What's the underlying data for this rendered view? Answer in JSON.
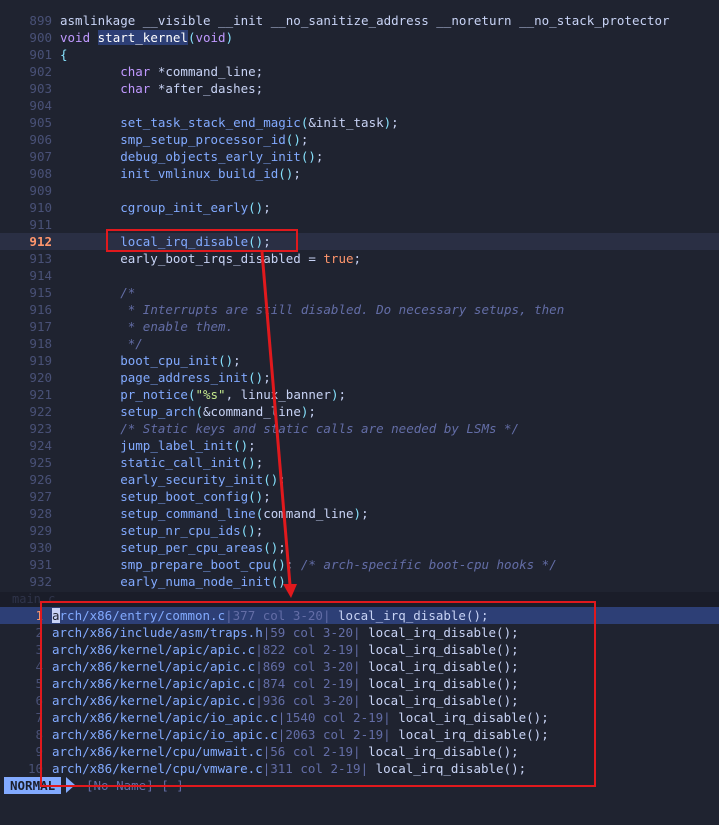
{
  "editor": {
    "lines": [
      {
        "num": "899",
        "parts": [
          [
            "",
            "asmlinkage __visible __init __no_sanitize_address __noreturn __no_stack_protector"
          ]
        ]
      },
      {
        "num": "900",
        "parts": [
          [
            "typ",
            "void"
          ],
          [
            "",
            " "
          ],
          [
            "hl",
            "start_kernel"
          ],
          [
            "punc",
            "("
          ],
          [
            "typ",
            "void"
          ],
          [
            "punc",
            ")"
          ]
        ]
      },
      {
        "num": "901",
        "parts": [
          [
            "punc",
            "{"
          ]
        ]
      },
      {
        "num": "902",
        "parts": [
          [
            "",
            "        "
          ],
          [
            "typ",
            "char"
          ],
          [
            "",
            " *command_line;"
          ]
        ]
      },
      {
        "num": "903",
        "parts": [
          [
            "",
            "        "
          ],
          [
            "typ",
            "char"
          ],
          [
            "",
            " *after_dashes;"
          ]
        ]
      },
      {
        "num": "904",
        "parts": []
      },
      {
        "num": "905",
        "parts": [
          [
            "",
            "        "
          ],
          [
            "fn",
            "set_task_stack_end_magic"
          ],
          [
            "punc",
            "("
          ],
          [
            "",
            "&init_task"
          ],
          [
            "punc",
            ")"
          ],
          [
            "",
            ";"
          ]
        ]
      },
      {
        "num": "906",
        "parts": [
          [
            "",
            "        "
          ],
          [
            "fn",
            "smp_setup_processor_id"
          ],
          [
            "punc",
            "()"
          ],
          [
            "",
            ";"
          ]
        ]
      },
      {
        "num": "907",
        "parts": [
          [
            "",
            "        "
          ],
          [
            "fn",
            "debug_objects_early_init"
          ],
          [
            "punc",
            "()"
          ],
          [
            "",
            ";"
          ]
        ]
      },
      {
        "num": "908",
        "parts": [
          [
            "",
            "        "
          ],
          [
            "fn",
            "init_vmlinux_build_id"
          ],
          [
            "punc",
            "()"
          ],
          [
            "",
            ";"
          ]
        ]
      },
      {
        "num": "909",
        "parts": []
      },
      {
        "num": "910",
        "parts": [
          [
            "",
            "        "
          ],
          [
            "fn",
            "cgroup_init_early"
          ],
          [
            "punc",
            "()"
          ],
          [
            "",
            ";"
          ]
        ]
      },
      {
        "num": "911",
        "parts": []
      },
      {
        "num": "912",
        "current": true,
        "parts": [
          [
            "",
            "        "
          ],
          [
            "fn",
            "local_irq_disable"
          ],
          [
            "punc",
            "()"
          ],
          [
            "",
            ";"
          ]
        ]
      },
      {
        "num": "913",
        "parts": [
          [
            "",
            "        early_boot_irqs_disabled = "
          ],
          [
            "bool",
            "true"
          ],
          [
            "",
            ";"
          ]
        ]
      },
      {
        "num": "914",
        "parts": []
      },
      {
        "num": "915",
        "parts": [
          [
            "",
            "        "
          ],
          [
            "cm",
            "/*"
          ]
        ]
      },
      {
        "num": "916",
        "parts": [
          [
            "",
            "        "
          ],
          [
            "cm",
            " * Interrupts are still disabled. Do necessary setups, then"
          ]
        ]
      },
      {
        "num": "917",
        "parts": [
          [
            "",
            "        "
          ],
          [
            "cm",
            " * enable them."
          ]
        ]
      },
      {
        "num": "918",
        "parts": [
          [
            "",
            "        "
          ],
          [
            "cm",
            " */"
          ]
        ]
      },
      {
        "num": "919",
        "parts": [
          [
            "",
            "        "
          ],
          [
            "fn",
            "boot_cpu_init"
          ],
          [
            "punc",
            "()"
          ],
          [
            "",
            ";"
          ]
        ]
      },
      {
        "num": "920",
        "parts": [
          [
            "",
            "        "
          ],
          [
            "fn",
            "page_address_init"
          ],
          [
            "punc",
            "()"
          ],
          [
            "",
            ";"
          ]
        ]
      },
      {
        "num": "921",
        "parts": [
          [
            "",
            "        "
          ],
          [
            "fn",
            "pr_notice"
          ],
          [
            "punc",
            "("
          ],
          [
            "str",
            "\"%s\""
          ],
          [
            "",
            ", linux_banner"
          ],
          [
            "punc",
            ")"
          ],
          [
            "",
            ";"
          ]
        ]
      },
      {
        "num": "922",
        "parts": [
          [
            "",
            "        "
          ],
          [
            "fn",
            "setup_arch"
          ],
          [
            "punc",
            "("
          ],
          [
            "",
            "&command_line"
          ],
          [
            "punc",
            ")"
          ],
          [
            "",
            ";"
          ]
        ]
      },
      {
        "num": "923",
        "parts": [
          [
            "",
            "        "
          ],
          [
            "cm",
            "/* Static keys and static calls are needed by LSMs */"
          ]
        ]
      },
      {
        "num": "924",
        "parts": [
          [
            "",
            "        "
          ],
          [
            "fn",
            "jump_label_init"
          ],
          [
            "punc",
            "()"
          ],
          [
            "",
            ";"
          ]
        ]
      },
      {
        "num": "925",
        "parts": [
          [
            "",
            "        "
          ],
          [
            "fn",
            "static_call_init"
          ],
          [
            "punc",
            "()"
          ],
          [
            "",
            ";"
          ]
        ]
      },
      {
        "num": "926",
        "parts": [
          [
            "",
            "        "
          ],
          [
            "fn",
            "early_security_init"
          ],
          [
            "punc",
            "()"
          ],
          [
            "",
            ";"
          ]
        ]
      },
      {
        "num": "927",
        "parts": [
          [
            "",
            "        "
          ],
          [
            "fn",
            "setup_boot_config"
          ],
          [
            "punc",
            "()"
          ],
          [
            "",
            ";"
          ]
        ]
      },
      {
        "num": "928",
        "parts": [
          [
            "",
            "        "
          ],
          [
            "fn",
            "setup_command_line"
          ],
          [
            "punc",
            "("
          ],
          [
            "",
            "command_line"
          ],
          [
            "punc",
            ")"
          ],
          [
            "",
            ";"
          ]
        ]
      },
      {
        "num": "929",
        "parts": [
          [
            "",
            "        "
          ],
          [
            "fn",
            "setup_nr_cpu_ids"
          ],
          [
            "punc",
            "()"
          ],
          [
            "",
            ";"
          ]
        ]
      },
      {
        "num": "930",
        "parts": [
          [
            "",
            "        "
          ],
          [
            "fn",
            "setup_per_cpu_areas"
          ],
          [
            "punc",
            "()"
          ],
          [
            "",
            ";"
          ]
        ]
      },
      {
        "num": "931",
        "parts": [
          [
            "",
            "        "
          ],
          [
            "fn",
            "smp_prepare_boot_cpu"
          ],
          [
            "punc",
            "()"
          ],
          [
            "",
            "; "
          ],
          [
            "cm",
            "/* arch-specific boot-cpu hooks */"
          ]
        ]
      },
      {
        "num": "932",
        "parts": [
          [
            "",
            "        "
          ],
          [
            "fn",
            "early_numa_node_init"
          ],
          [
            "punc",
            "()"
          ],
          [
            "",
            ";"
          ]
        ]
      }
    ]
  },
  "split_label": "main.c",
  "quickfix": {
    "items": [
      {
        "num": "1",
        "file": "arch/x86/entry/common.c",
        "loc": "377 col 3-20",
        "code": "local_irq_disable();",
        "selected": true
      },
      {
        "num": "2",
        "file": "arch/x86/include/asm/traps.h",
        "loc": "59 col 3-20",
        "code": "local_irq_disable();"
      },
      {
        "num": "3",
        "file": "arch/x86/kernel/apic/apic.c",
        "loc": "822 col 2-19",
        "code": "local_irq_disable();"
      },
      {
        "num": "4",
        "file": "arch/x86/kernel/apic/apic.c",
        "loc": "869 col 3-20",
        "code": "local_irq_disable();"
      },
      {
        "num": "5",
        "file": "arch/x86/kernel/apic/apic.c",
        "loc": "874 col 2-19",
        "code": "local_irq_disable();"
      },
      {
        "num": "6",
        "file": "arch/x86/kernel/apic/apic.c",
        "loc": "936 col 3-20",
        "code": "local_irq_disable();"
      },
      {
        "num": "7",
        "file": "arch/x86/kernel/apic/io_apic.c",
        "loc": "1540 col 2-19",
        "code": "local_irq_disable();"
      },
      {
        "num": "8",
        "file": "arch/x86/kernel/apic/io_apic.c",
        "loc": "2063 col 2-19",
        "code": "local_irq_disable();"
      },
      {
        "num": "9",
        "file": "arch/x86/kernel/cpu/umwait.c",
        "loc": "56 col 2-19",
        "code": "local_irq_disable();"
      },
      {
        "num": "10",
        "file": "arch/x86/kernel/cpu/vmware.c",
        "loc": "311 col 2-19",
        "code": "local_irq_disable();"
      }
    ]
  },
  "statusline": {
    "mode": "NORMAL",
    "buffer": "[No Name] [-]"
  },
  "colors": {
    "annotation": "#e0191d",
    "background": "#1f2330"
  }
}
